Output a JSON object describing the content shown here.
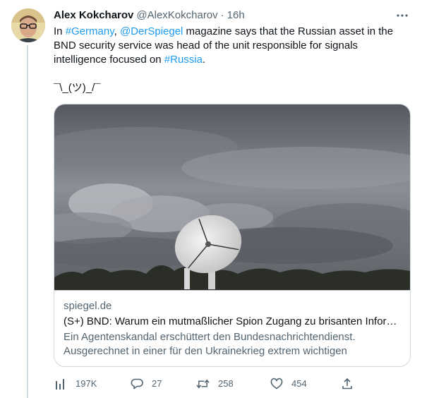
{
  "tweet": {
    "author_name": "Alex Kokcharov",
    "handle": "@AlexKokcharov",
    "separator": "·",
    "time": "16h",
    "text_parts": {
      "p1": "In ",
      "tag_germany": "#Germany",
      "p2": ", ",
      "mention_spiegel": "@DerSpiegel",
      "p3": " magazine says that the Russian asset in the BND security service was head of the unit responsible for signals intelligence focused on ",
      "tag_russia": "#Russia",
      "p4": "."
    },
    "shrug": "¯\\_(ツ)_/¯"
  },
  "card": {
    "domain": "spiegel.de",
    "title": "(S+) BND: Warum ein mutmaßlicher Spion Zugang zu brisanten Informationen hatte",
    "description": "Ein Agentenskandal erschüttert den Bundesnachrichtendienst. Ausgerechnet in einer für den Ukrainekrieg extrem wichtigen Abteilung..."
  },
  "actions": {
    "views": "197K",
    "replies": "27",
    "retweets": "258",
    "likes": "454"
  },
  "icons": {
    "more": "more-horizontal-icon",
    "views": "bar-chart-icon",
    "reply": "speech-bubble-icon",
    "retweet": "retweet-arrows-icon",
    "like": "heart-icon",
    "share": "share-upload-icon"
  },
  "colors": {
    "link": "#1d9bf0",
    "secondary_text": "#536471",
    "border": "#cfd9de"
  }
}
